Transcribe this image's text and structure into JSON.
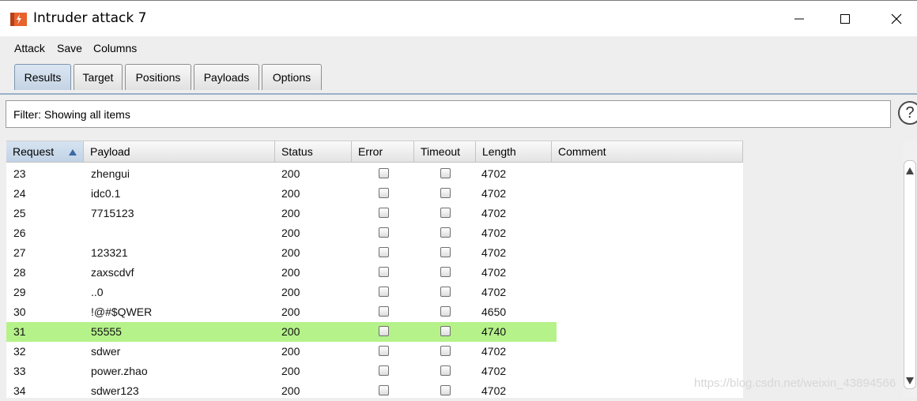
{
  "window": {
    "title": "Intruder attack 7",
    "minimize_glyph": "—",
    "maximize_glyph": "☐",
    "close_glyph": "✕"
  },
  "menu": [
    "Attack",
    "Save",
    "Columns"
  ],
  "tabs": [
    {
      "label": "Results",
      "active": true
    },
    {
      "label": "Target",
      "active": false
    },
    {
      "label": "Positions",
      "active": false
    },
    {
      "label": "Payloads",
      "active": false
    },
    {
      "label": "Options",
      "active": false
    }
  ],
  "filter": {
    "text": "Filter: Showing all items"
  },
  "help_glyph": "?",
  "table": {
    "columns": [
      "Request",
      "Payload",
      "Status",
      "Error",
      "Timeout",
      "Length",
      "Comment"
    ],
    "sorted_column": "Request",
    "rows": [
      {
        "request": "23",
        "payload": "zhengui",
        "status": "200",
        "error": false,
        "timeout": false,
        "length": "4702",
        "comment": "",
        "highlighted": false
      },
      {
        "request": "24",
        "payload": "idc0.1",
        "status": "200",
        "error": false,
        "timeout": false,
        "length": "4702",
        "comment": "",
        "highlighted": false
      },
      {
        "request": "25",
        "payload": "7715123",
        "status": "200",
        "error": false,
        "timeout": false,
        "length": "4702",
        "comment": "",
        "highlighted": false
      },
      {
        "request": "26",
        "payload": "",
        "status": "200",
        "error": false,
        "timeout": false,
        "length": "4702",
        "comment": "",
        "highlighted": false
      },
      {
        "request": "27",
        "payload": "123321",
        "status": "200",
        "error": false,
        "timeout": false,
        "length": "4702",
        "comment": "",
        "highlighted": false
      },
      {
        "request": "28",
        "payload": "zaxscdvf",
        "status": "200",
        "error": false,
        "timeout": false,
        "length": "4702",
        "comment": "",
        "highlighted": false
      },
      {
        "request": "29",
        "payload": "..0",
        "status": "200",
        "error": false,
        "timeout": false,
        "length": "4702",
        "comment": "",
        "highlighted": false
      },
      {
        "request": "30",
        "payload": "!@#$QWER",
        "status": "200",
        "error": false,
        "timeout": false,
        "length": "4650",
        "comment": "",
        "highlighted": false
      },
      {
        "request": "31",
        "payload": "55555",
        "status": "200",
        "error": false,
        "timeout": false,
        "length": "4740",
        "comment": "",
        "highlighted": true
      },
      {
        "request": "32",
        "payload": "sdwer",
        "status": "200",
        "error": false,
        "timeout": false,
        "length": "4702",
        "comment": "",
        "highlighted": false
      },
      {
        "request": "33",
        "payload": "power.zhao",
        "status": "200",
        "error": false,
        "timeout": false,
        "length": "4702",
        "comment": "",
        "highlighted": false
      },
      {
        "request": "34",
        "payload": "sdwer123",
        "status": "200",
        "error": false,
        "timeout": false,
        "length": "4702",
        "comment": "",
        "highlighted": false
      }
    ]
  },
  "watermark": "https://blog.csdn.net/weixin_43894566",
  "colors": {
    "highlight": "#b5f28a",
    "active_tab": "#c4d3e4",
    "app_icon": "#e8622c"
  }
}
